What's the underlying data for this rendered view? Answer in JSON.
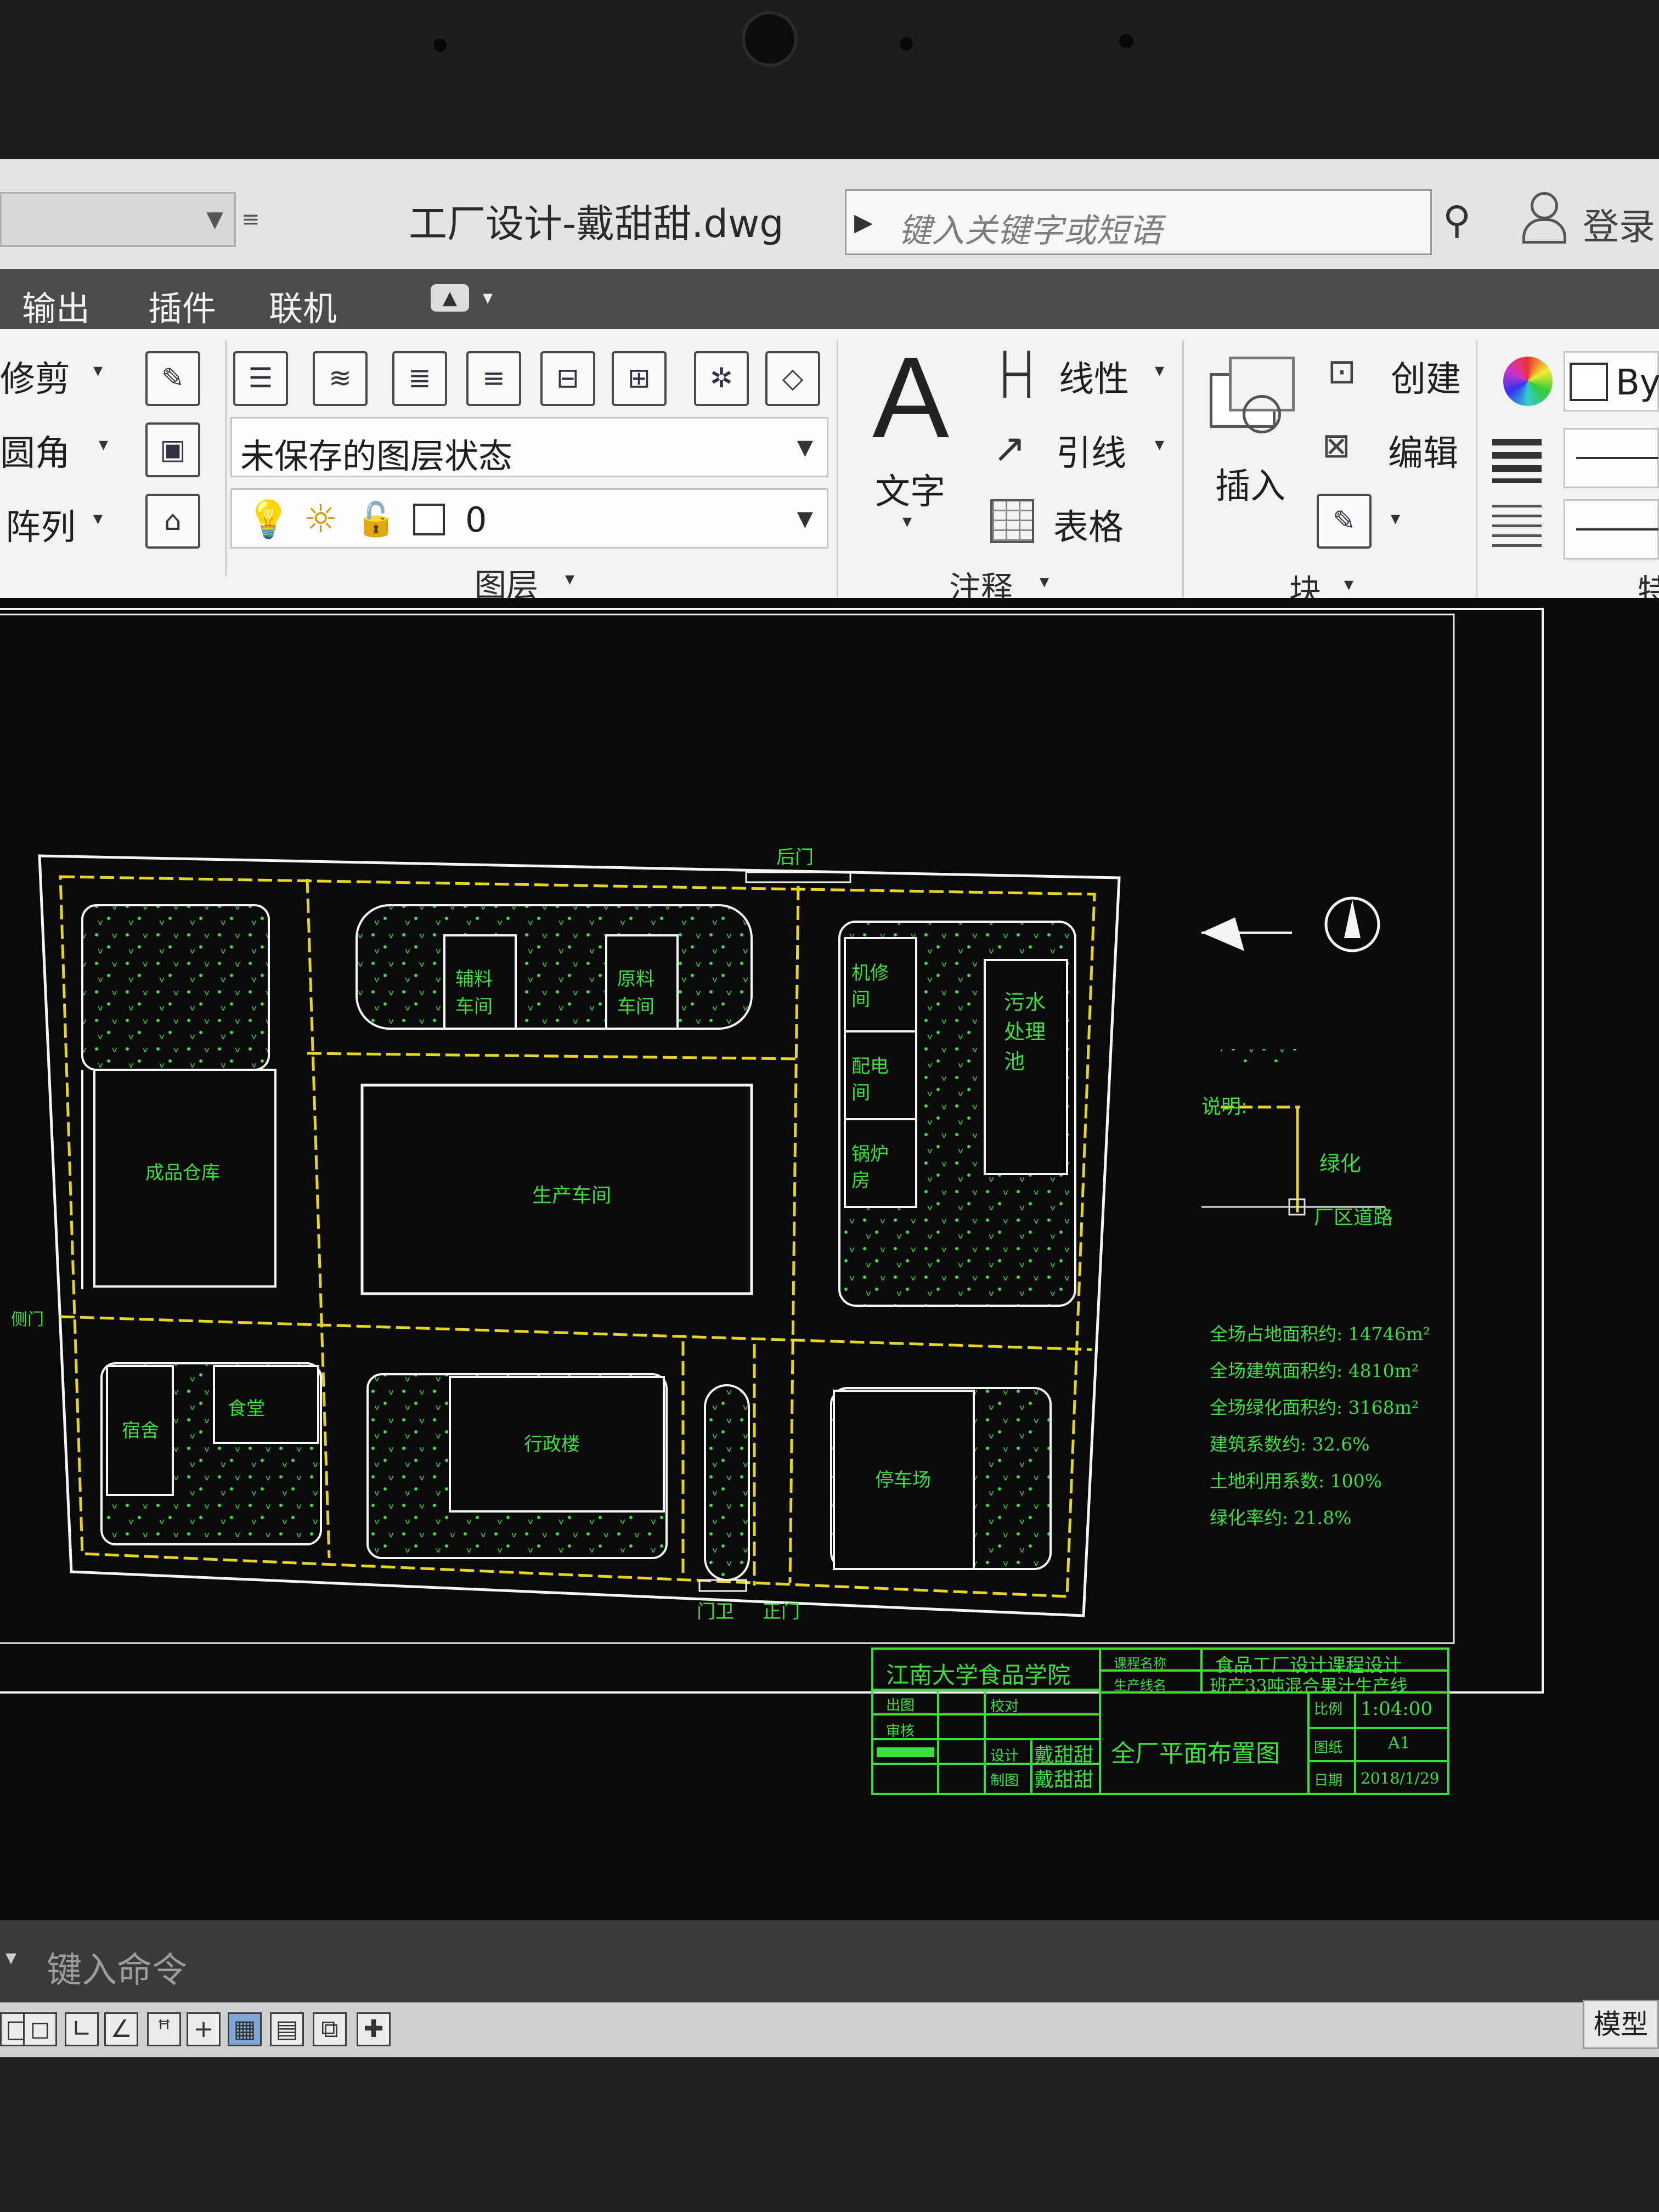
{
  "window": {
    "file_title": "工厂设计-戴甜甜.dwg",
    "search_placeholder": "键入关键字或短语",
    "login_label": "登录"
  },
  "menu": [
    "输出",
    "插件",
    "联机"
  ],
  "ribbon": {
    "modify": {
      "trim": "修剪",
      "fillet": "圆角",
      "array": "阵列"
    },
    "layers": {
      "state": "未保存的图层状态",
      "current_layer": "0",
      "panel_label": "图层"
    },
    "annotation": {
      "text": "文字",
      "linear": "线性",
      "leader": "引线",
      "table": "表格",
      "panel_label": "注释"
    },
    "block": {
      "insert": "插入",
      "create": "创建",
      "edit": "编辑",
      "panel_label": "块"
    },
    "properties": {
      "bylayer": "By",
      "panel_label": "特"
    }
  },
  "drawing": {
    "gates": {
      "back": "后门",
      "side": "侧门",
      "guard": "门卫",
      "main": "正门"
    },
    "buildings": {
      "aux_material": "辅料车间",
      "raw_material": "原料车间",
      "repair": "机修间",
      "sewage": "污水处理池",
      "power": "配电间",
      "boiler": "锅炉房",
      "warehouse": "成品仓库",
      "production": "生产车间",
      "dorm": "宿舍",
      "canteen": "食堂",
      "admin": "行政楼",
      "parking": "停车场"
    },
    "legend": {
      "title": "说明:",
      "green_label": "绿化",
      "road_label": "厂区道路"
    },
    "stats": [
      "全场占地面积约: 14746m²",
      "全场建筑面积约: 4810m²",
      "全场绿化面积约: 3168m²",
      "建筑系数约: 32.6%",
      "土地利用系数: 100%",
      "绿化率约: 21.8%"
    ],
    "title_block": {
      "school": "江南大学食品学院",
      "course_key": "课程名称",
      "course": "食品工厂设计课程设计",
      "line_key": "生产线名",
      "line": "班产33吨混合果汁生产线",
      "drawer_key": "出图",
      "proof_key": "校对",
      "review_key": "审核",
      "design_key": "设计",
      "design_name": "戴甜甜",
      "draft_key": "制图",
      "draft_name": "戴甜甜",
      "drawing_name": "全厂平面布置图",
      "scale_key": "比例",
      "scale": "1:04:00",
      "size_key": "图纸",
      "size": "A1",
      "date_key": "日期",
      "date": "2018/1/29"
    }
  },
  "command": {
    "placeholder": "键入命令"
  },
  "status": {
    "model_tab": "模型"
  }
}
